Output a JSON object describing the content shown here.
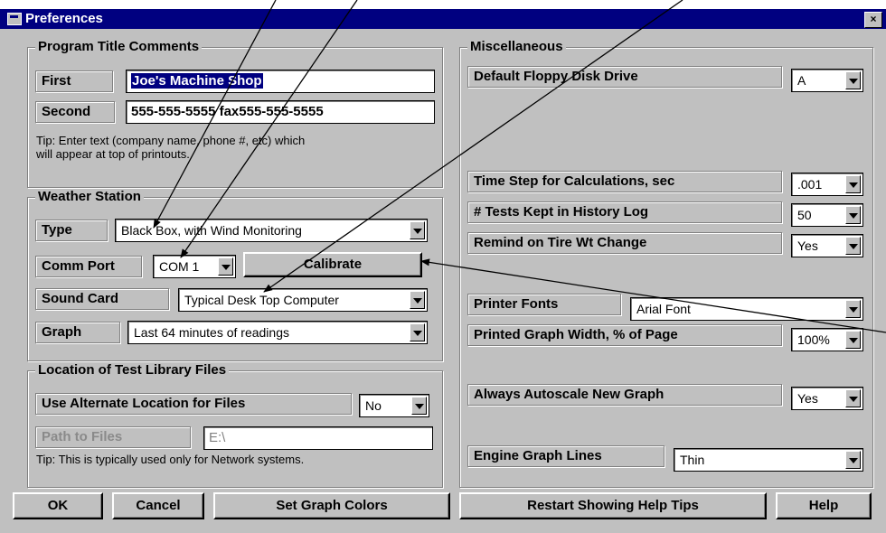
{
  "window": {
    "title": "Preferences",
    "close": "×"
  },
  "program_title": {
    "legend": "Program Title Comments",
    "first_label": "First",
    "first_value": "Joe's Machine Shop",
    "second_label": "Second",
    "second_value": "555-555-5555 fax555-555-5555",
    "tip_line1": "Tip:  Enter text (company name, phone #, etc) which",
    "tip_line2": "will appear at top of printouts."
  },
  "weather": {
    "legend": "Weather Station",
    "type_label": "Type",
    "type_value": "Black Box, with Wind Monitoring",
    "comm_label": "Comm Port",
    "comm_value": "COM 1",
    "calibrate": "Calibrate",
    "sound_label": "Sound Card",
    "sound_value": "Typical Desk Top Computer",
    "graph_label": "Graph",
    "graph_value": "Last 64 minutes of readings"
  },
  "location": {
    "legend": "Location of Test Library Files",
    "alt_label": "Use Alternate Location for Files",
    "alt_value": "No",
    "path_label": "Path to Files",
    "path_value": "E:\\",
    "tip": "Tip:  This is typically used only for Network systems."
  },
  "misc": {
    "legend": "Miscellaneous",
    "floppy_label": "Default Floppy Disk Drive",
    "floppy_value": "A",
    "timestep_label": "Time Step for Calculations, sec",
    "timestep_value": ".001",
    "tests_label": "# Tests Kept in History Log",
    "tests_value": "50",
    "tire_label": "Remind on Tire Wt Change",
    "tire_value": "Yes",
    "fonts_label": "Printer Fonts",
    "fonts_value": "Arial Font",
    "width_label": "Printed Graph Width, % of Page",
    "width_value": "100%",
    "autoscale_label": "Always Autoscale New Graph",
    "autoscale_value": "Yes",
    "lines_label": "Engine Graph Lines",
    "lines_value": "Thin"
  },
  "buttons": {
    "ok": "OK",
    "cancel": "Cancel",
    "colors": "Set Graph Colors",
    "restart": "Restart Showing Help Tips",
    "help": "Help"
  },
  "colors": {
    "titlebar": "#000080",
    "face": "#c0c0c0"
  }
}
